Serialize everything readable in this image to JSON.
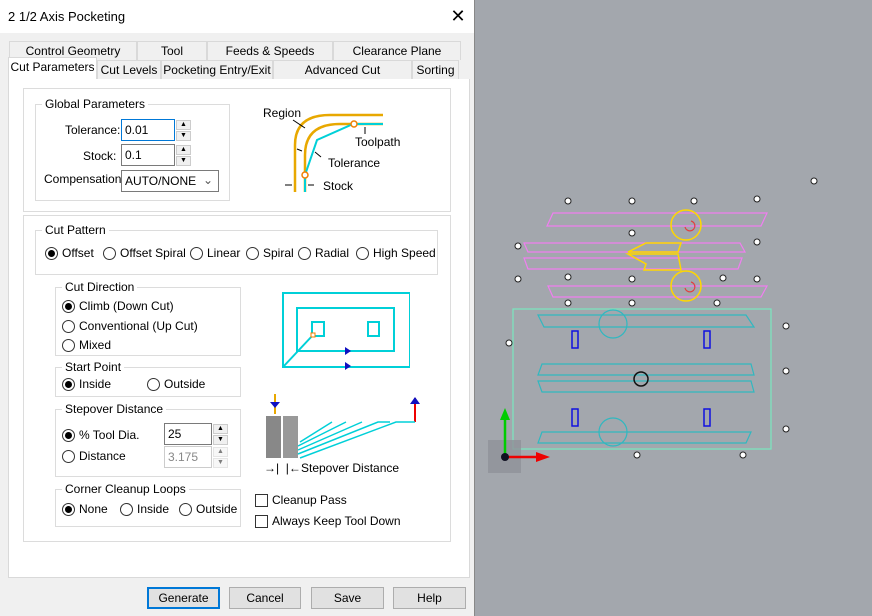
{
  "dialog": {
    "title": "2 1/2 Axis Pocketing",
    "close_icon": "close-icon"
  },
  "tabs_row1": [
    "Control Geometry",
    "Tool",
    "Feeds & Speeds",
    "Clearance Plane"
  ],
  "tabs_row2": [
    "Cut Parameters",
    "Cut Levels",
    "Pocketing Entry/Exit",
    "Advanced Cut Parameters",
    "Sorting"
  ],
  "active_tab": "Cut Parameters",
  "global": {
    "title": "Global Parameters",
    "tolerance_label": "Tolerance:",
    "tolerance": "0.01",
    "stock_label": "Stock:",
    "stock": "0.1",
    "compensation_label": "Compensation:",
    "compensation": "AUTO/NONE"
  },
  "diagram1": {
    "region": "Region",
    "toolpath": "Toolpath",
    "tolerance": "Tolerance",
    "stock": "Stock"
  },
  "cut_pattern": {
    "title": "Cut Pattern",
    "options": [
      "Offset",
      "Offset Spiral",
      "Linear",
      "Spiral",
      "Radial",
      "High Speed"
    ],
    "selected": "Offset"
  },
  "cut_direction": {
    "title": "Cut Direction",
    "options": [
      "Climb (Down Cut)",
      "Conventional (Up Cut)",
      "Mixed"
    ],
    "selected": "Climb (Down Cut)"
  },
  "start_point": {
    "title": "Start Point",
    "options": [
      "Inside",
      "Outside"
    ],
    "selected": "Inside"
  },
  "stepover": {
    "title": "Stepover Distance",
    "tool_dia_label": "% Tool Dia.",
    "tool_dia": "25",
    "distance_label": "Distance",
    "distance": "3.175",
    "selected": "% Tool Dia."
  },
  "diagram2": {
    "stepover_label": "Stepover Distance"
  },
  "corner_cleanup": {
    "title": "Corner Cleanup Loops",
    "options": [
      "None",
      "Inside",
      "Outside"
    ],
    "selected": "None"
  },
  "checkboxes": [
    {
      "label": "Cleanup Pass",
      "checked": false
    },
    {
      "label": "Always Keep Tool Down",
      "checked": false
    }
  ],
  "buttons": {
    "generate": "Generate",
    "cancel": "Cancel",
    "save": "Save",
    "help": "Help"
  },
  "colors": {
    "toolpath": "#00d0d8",
    "region": "#e8a800",
    "pink": "#f07ef0",
    "selected": "#ffd700",
    "blue": "#1010e0"
  }
}
